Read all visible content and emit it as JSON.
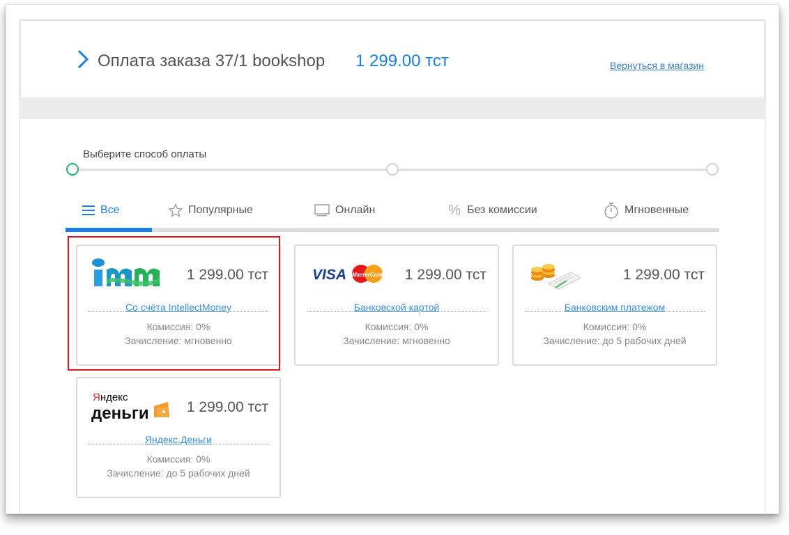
{
  "header": {
    "title": "Оплата заказа 37/1 bookshop",
    "amount": "1 299.00 тст",
    "back_link": "Вернуться в магазин"
  },
  "steps": {
    "label": "Выберите способ оплаты",
    "count": 3,
    "active_index": 0
  },
  "tabs": [
    {
      "label": "Все",
      "icon": "list-icon",
      "active": true
    },
    {
      "label": "Популярные",
      "icon": "star-icon",
      "active": false
    },
    {
      "label": "Онлайн",
      "icon": "monitor-icon",
      "active": false
    },
    {
      "label": "Без комиссии",
      "icon": "percent-icon",
      "active": false
    },
    {
      "label": "Мгновенные",
      "icon": "stopwatch-icon",
      "active": false
    }
  ],
  "methods": [
    {
      "name": "Со счёта IntellectMoney",
      "logo": "intellectmoney-logo",
      "price": "1 299.00 тст",
      "commission": "Комиссия: 0%",
      "credit": "Зачисление: мгновенно",
      "highlighted": true
    },
    {
      "name": "Банковской картой",
      "logo": "visa-mastercard-logo",
      "price": "1 299.00 тст",
      "commission": "Комиссия: 0%",
      "credit": "Зачисление: мгновенно",
      "highlighted": false
    },
    {
      "name": "Банковским платежом",
      "logo": "coins-document-icon",
      "price": "1 299.00 тст",
      "commission": "Комиссия: 0%",
      "credit": "Зачисление: до 5 рабочих дней",
      "highlighted": false
    },
    {
      "name": "Яндекс.Деньги",
      "logo": "yandex-money-logo",
      "logo_text_top": "Яндекс",
      "logo_text_bottom": "деньги",
      "price": "1 299.00 тст",
      "commission": "Комиссия: 0%",
      "credit": "Зачисление: до 5 рабочих дней",
      "highlighted": false
    }
  ],
  "logo_texts": {
    "visa": "VISA",
    "mastercard": "MasterCard"
  },
  "colors": {
    "accent": "#1a7fe2",
    "step_active": "#22b36e",
    "highlight": "#e3161c",
    "yandex_red": "#e52620",
    "yandex_orange": "#f49a2c"
  }
}
